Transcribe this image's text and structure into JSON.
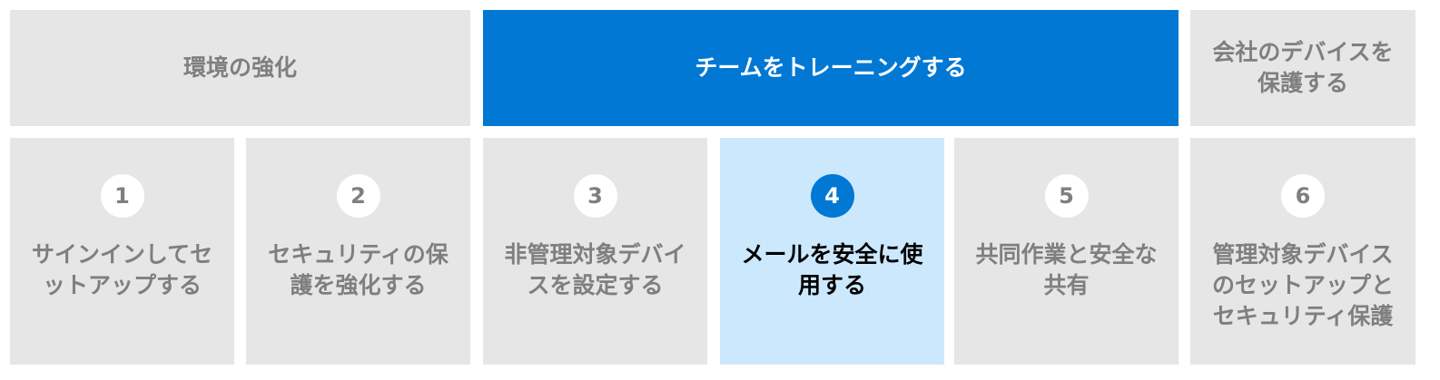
{
  "phases": [
    {
      "label": "環境の強化",
      "active": false
    },
    {
      "label": "チームをトレーニングする",
      "active": true
    },
    {
      "label": "会社のデバイスを保護する",
      "active": false
    }
  ],
  "steps": [
    {
      "number": "1",
      "label": "サインインしてセットアップする"
    },
    {
      "number": "2",
      "label": "セキュリティの保護を強化する"
    },
    {
      "number": "3",
      "label": "非管理対象デバイスを設定する"
    },
    {
      "number": "4",
      "label": "メールを安全に使用する"
    },
    {
      "number": "5",
      "label": "共同作業と安全な共有"
    },
    {
      "number": "6",
      "label": "管理対象デバイスのセットアップとセキュリティ保護"
    }
  ],
  "colors": {
    "accent": "#0078d4",
    "active_step_bg": "#cce8fc",
    "inactive_bg": "#e6e6e6",
    "inactive_text": "#7f7f7f"
  }
}
